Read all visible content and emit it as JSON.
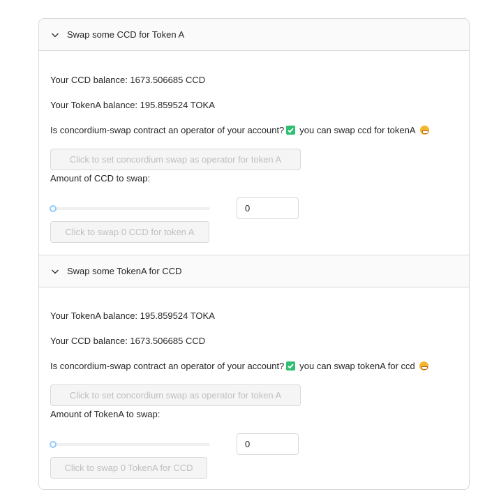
{
  "panels": [
    {
      "title": "Swap some CCD for Token A",
      "balance_line_1": "Your CCD balance: 1673.506685 CCD",
      "balance_line_2": "Your TokenA balance: 195.859524 TOKA",
      "operator_question": "Is concordium-swap contract an operator of your account?",
      "operator_status": "you can swap ccd for tokenA",
      "set_operator_button": "Click to set concordium swap as operator for token A",
      "amount_label": "Amount of CCD to swap:",
      "amount_value": "0",
      "slider_value": 0,
      "swap_button": "Click to swap 0 CCD for token A"
    },
    {
      "title": "Swap some TokenA for CCD",
      "balance_line_1": "Your TokenA balance: 195.859524 TOKA",
      "balance_line_2": "Your CCD balance: 1673.506685 CCD",
      "operator_question": "Is concordium-swap contract an operator of your account?",
      "operator_status": "you can swap tokenA for ccd",
      "set_operator_button": "Click to set concordium swap as operator for token A",
      "amount_label": "Amount of TokenA to swap:",
      "amount_value": "0",
      "slider_value": 0,
      "swap_button": "Click to swap 0 TokenA for CCD"
    }
  ],
  "icons": {
    "panel_expand": "chevron-down-icon",
    "operator_ok": "check-box-icon",
    "status_emoji": "grinning-face-icon"
  },
  "colors": {
    "check_green": "#2fbf71",
    "slider_handle": "#91caff",
    "border": "#d9d9d9",
    "header_bg": "#fafafa",
    "disabled_text": "#bfbfbf"
  }
}
